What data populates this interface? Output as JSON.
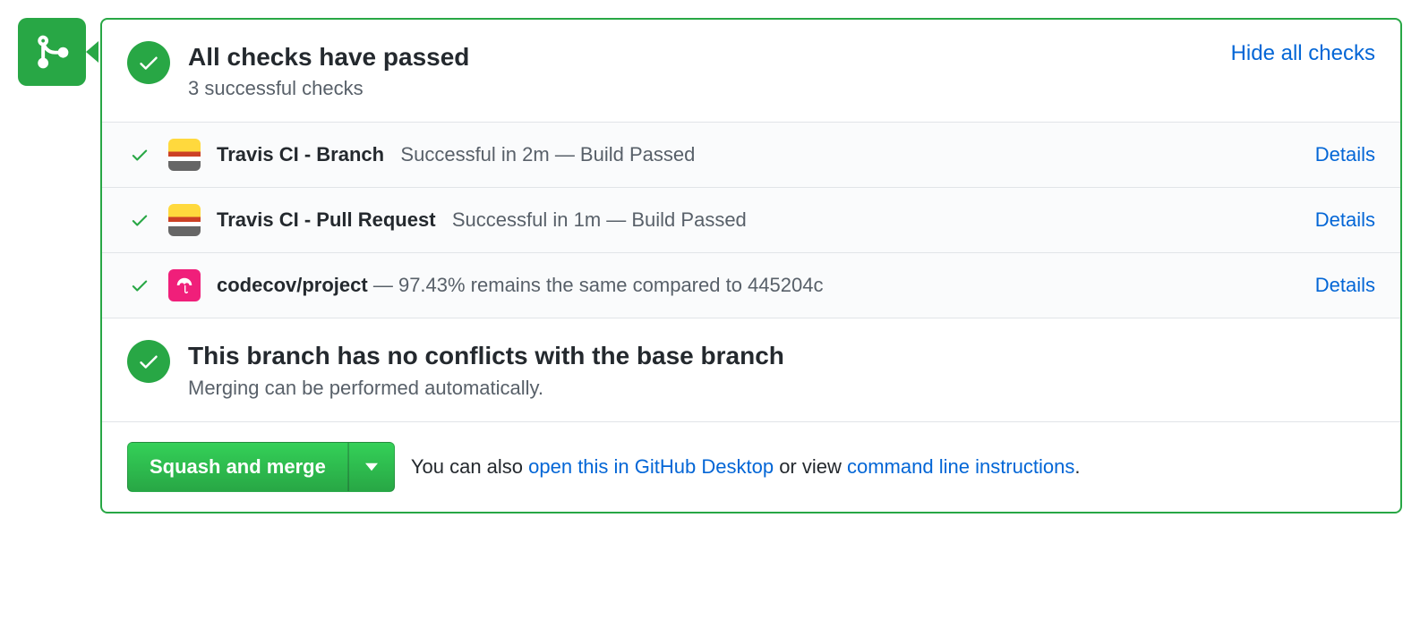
{
  "header": {
    "title": "All checks have passed",
    "subtitle": "3 successful checks",
    "hide_link": "Hide all checks"
  },
  "checks": [
    {
      "name": "Travis CI - Branch",
      "status": "Successful in 2m — Build Passed",
      "details": "Details"
    },
    {
      "name": "Travis CI - Pull Request",
      "status": "Successful in 1m — Build Passed",
      "details": "Details"
    },
    {
      "name": "codecov/project",
      "status": "— 97.43% remains the same compared to 445204c",
      "details": "Details"
    }
  ],
  "conflicts": {
    "title": "This branch has no conflicts with the base branch",
    "subtitle": "Merging can be performed automatically."
  },
  "footer": {
    "merge_button": "Squash and merge",
    "text_prefix": "You can also ",
    "desktop_link": "open this in GitHub Desktop",
    "text_middle": " or view ",
    "cli_link": "command line instructions",
    "text_suffix": "."
  }
}
